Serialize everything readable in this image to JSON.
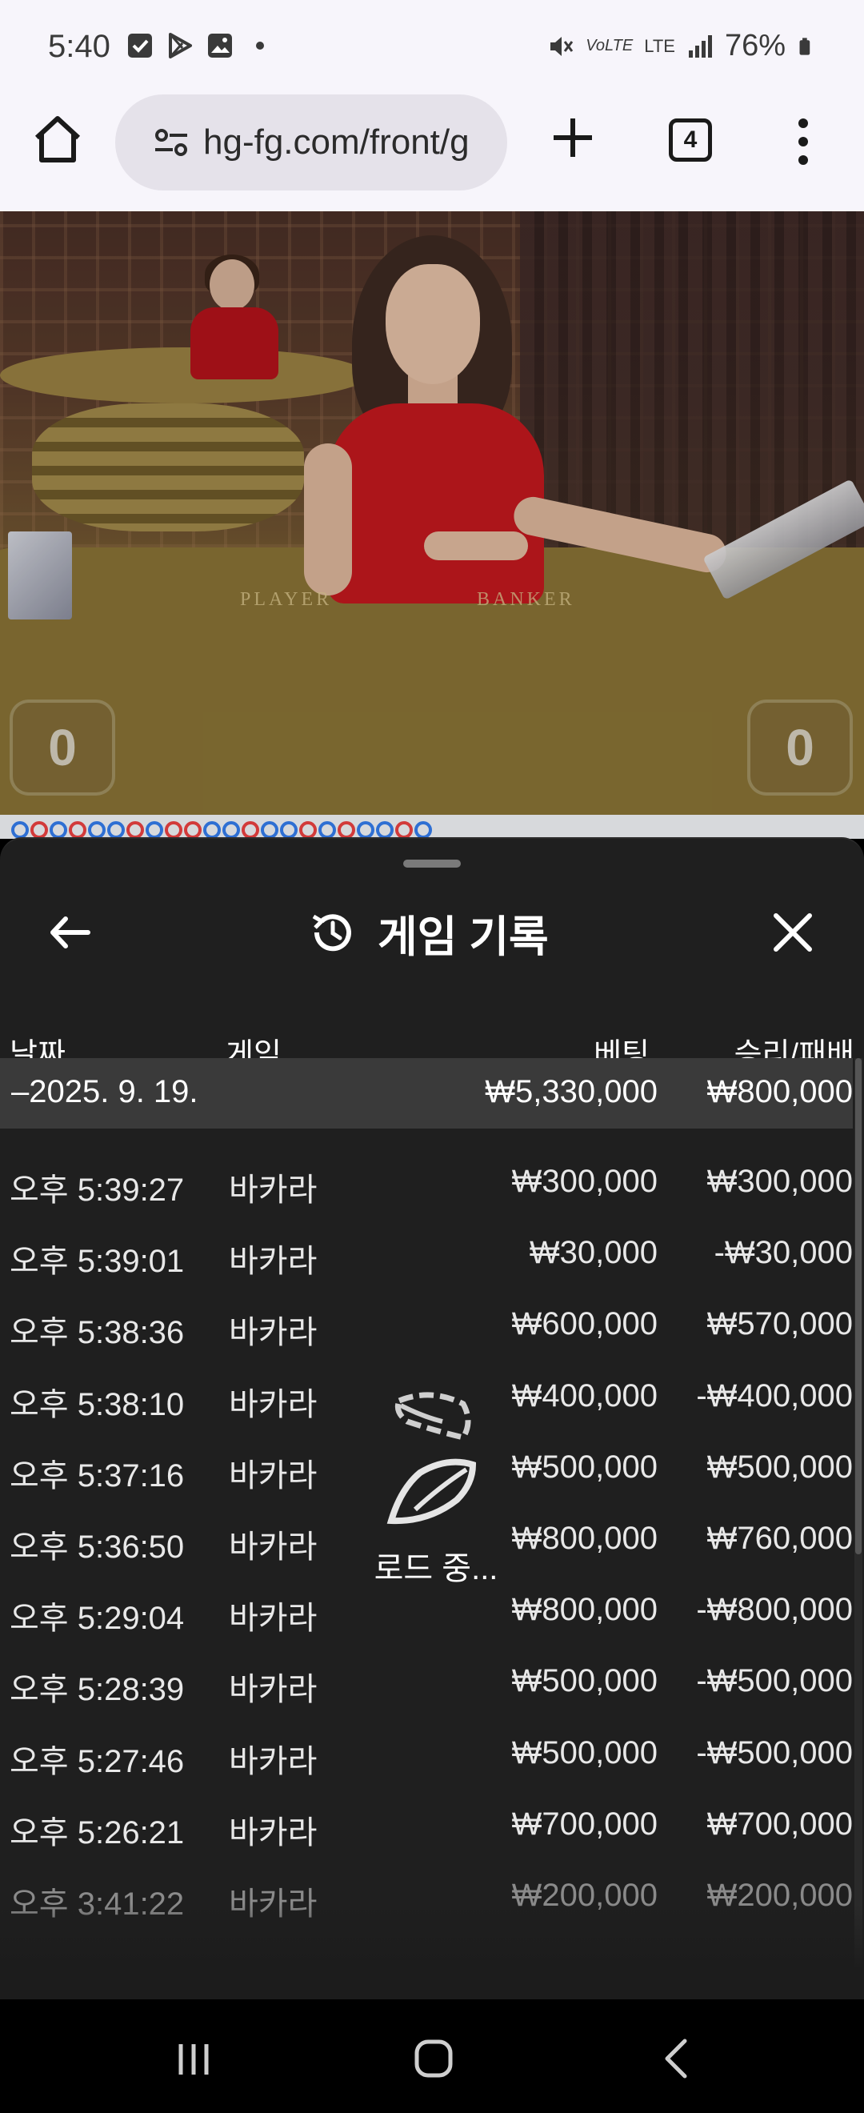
{
  "status_bar": {
    "time": "5:40",
    "left_icons": [
      "check-icon",
      "play-store-icon",
      "image-icon",
      "dot-icon"
    ],
    "right_icons": [
      "mute-icon",
      "volte-icon",
      "lte-icon",
      "signal-icon",
      "battery-icon"
    ],
    "volte": "VoLTE",
    "lte": "LTE",
    "battery": "76%"
  },
  "browser": {
    "url": "hg-fg.com/front/g",
    "tab_count": "4"
  },
  "video": {
    "player_label": "PLAYER",
    "banker_label": "BANKER",
    "player_score": "0",
    "banker_score": "0"
  },
  "sheet": {
    "title": "게임 기록",
    "columns": {
      "date": "날짜",
      "game": "게임",
      "bet": "베팅",
      "win_loss": "승리/패배"
    },
    "summary": {
      "date": "–2025. 9. 19.",
      "bet": "₩5,330,000",
      "win_loss": "₩800,000"
    },
    "rows": [
      {
        "time": "오후 5:39:27",
        "game": "바카라",
        "bet": "₩300,000",
        "win_loss": "₩300,000"
      },
      {
        "time": "오후 5:39:01",
        "game": "바카라",
        "bet": "₩30,000",
        "win_loss": "-₩30,000"
      },
      {
        "time": "오후 5:38:36",
        "game": "바카라",
        "bet": "₩600,000",
        "win_loss": "₩570,000"
      },
      {
        "time": "오후 5:38:10",
        "game": "바카라",
        "bet": "₩400,000",
        "win_loss": "-₩400,000"
      },
      {
        "time": "오후 5:37:16",
        "game": "바카라",
        "bet": "₩500,000",
        "win_loss": "₩500,000"
      },
      {
        "time": "오후 5:36:50",
        "game": "바카라",
        "bet": "₩800,000",
        "win_loss": "₩760,000"
      },
      {
        "time": "오후 5:29:04",
        "game": "바카라",
        "bet": "₩800,000",
        "win_loss": "-₩800,000"
      },
      {
        "time": "오후 5:28:39",
        "game": "바카라",
        "bet": "₩500,000",
        "win_loss": "-₩500,000"
      },
      {
        "time": "오후 5:27:46",
        "game": "바카라",
        "bet": "₩500,000",
        "win_loss": "-₩500,000"
      },
      {
        "time": "오후 5:26:21",
        "game": "바카라",
        "bet": "₩700,000",
        "win_loss": "₩700,000"
      },
      {
        "time": "오후 3:41:22",
        "game": "바카라",
        "bet": "₩200,000",
        "win_loss": "₩200,000"
      }
    ],
    "loading_text": "로드 중..."
  },
  "nav_bar": {
    "buttons": [
      "recents-icon",
      "home-icon",
      "back-icon"
    ]
  },
  "colors": {
    "sheet_bg": "#1f1f1f",
    "summary_bg": "#3a3a3a",
    "browser_bg": "#f7f5fb",
    "road_blue": "#2e6fd3",
    "road_red": "#d23a3a"
  }
}
